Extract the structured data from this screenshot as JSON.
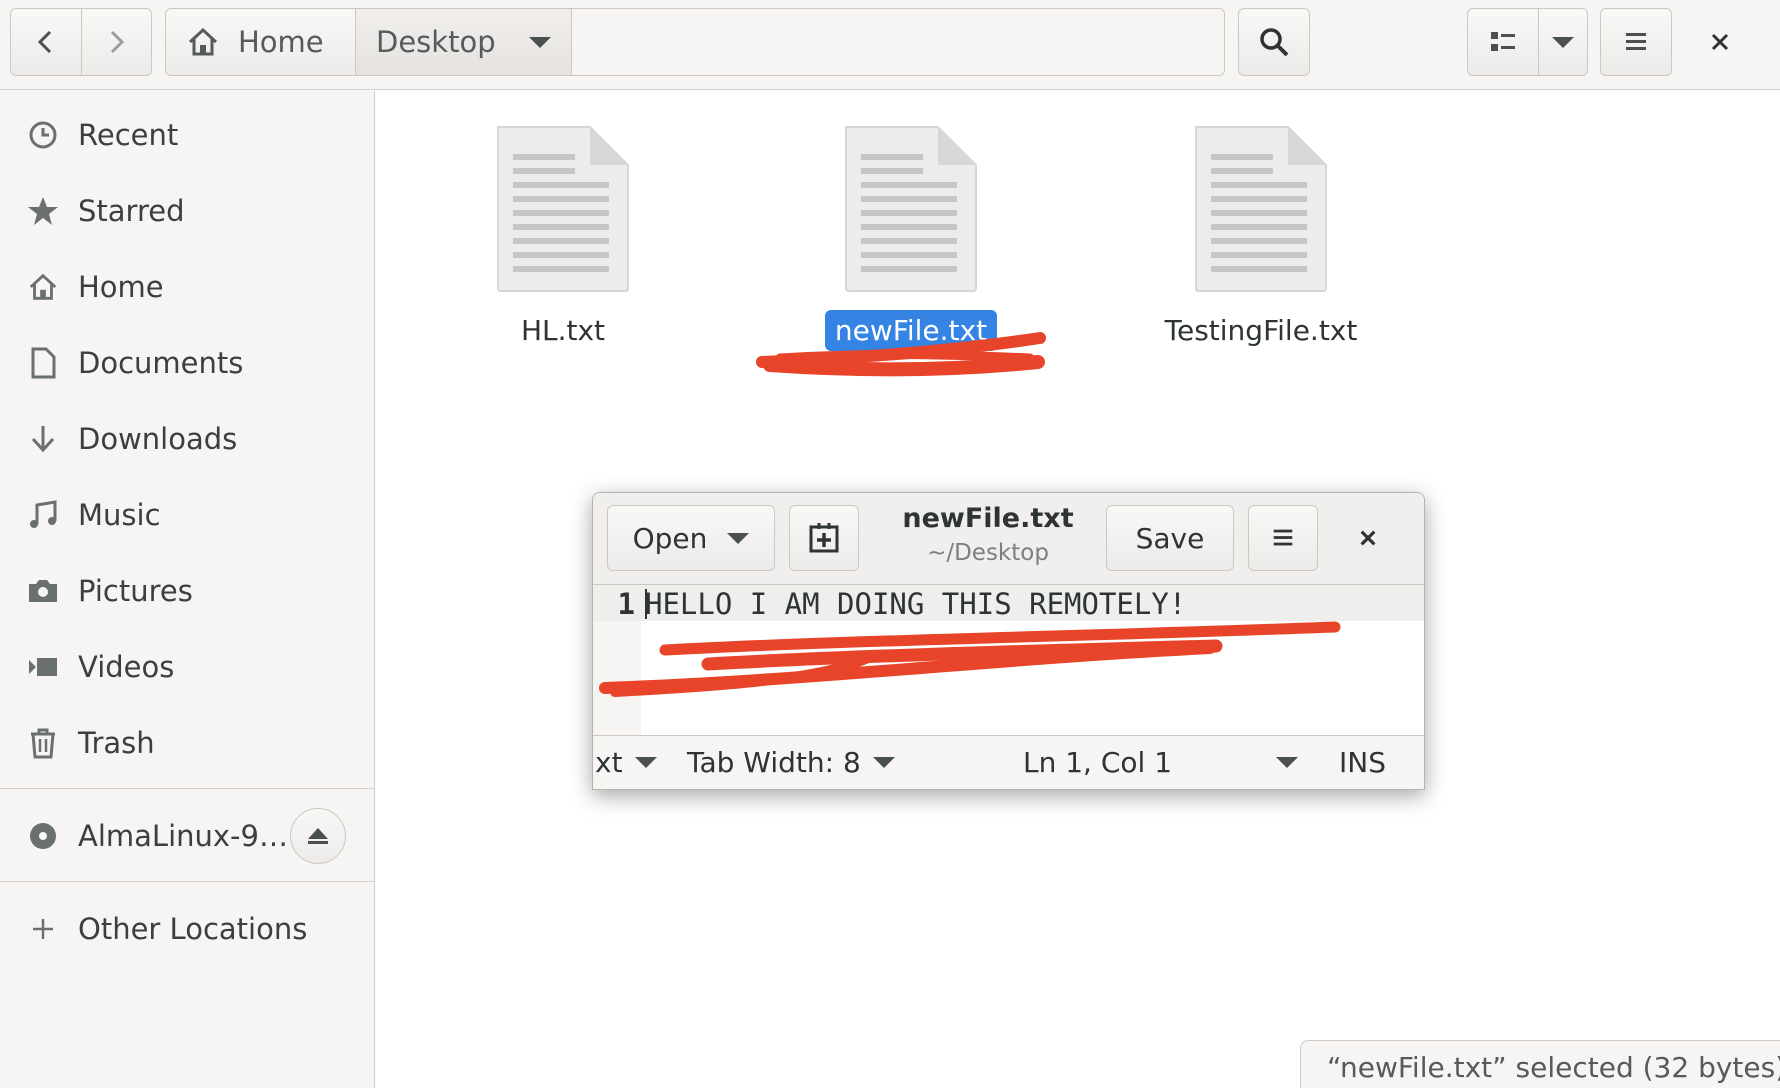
{
  "header": {
    "back_icon": "go-back-icon",
    "forward_icon": "go-forward-icon",
    "breadcrumbs": [
      {
        "label": "Home",
        "icon": "home-icon"
      },
      {
        "label": "Desktop"
      }
    ],
    "search_icon": "search-icon",
    "view_icon": "list-view-icon",
    "menu_icon": "hamburger-icon",
    "close_icon": "close-icon"
  },
  "sidebar": {
    "items": [
      {
        "label": "Recent",
        "icon": "clock-icon"
      },
      {
        "label": "Starred",
        "icon": "star-icon"
      },
      {
        "label": "Home",
        "icon": "home-icon"
      },
      {
        "label": "Documents",
        "icon": "document-icon"
      },
      {
        "label": "Downloads",
        "icon": "download-icon"
      },
      {
        "label": "Music",
        "icon": "music-icon"
      },
      {
        "label": "Pictures",
        "icon": "camera-icon"
      },
      {
        "label": "Videos",
        "icon": "video-icon"
      },
      {
        "label": "Trash",
        "icon": "trash-icon"
      }
    ],
    "device": {
      "label": "AlmaLinux-9…",
      "icon": "disc-icon",
      "eject_icon": "eject-icon"
    },
    "other": {
      "label": "Other Locations",
      "icon": "plus-icon"
    }
  },
  "files": [
    {
      "name": "HL.txt",
      "selected": false
    },
    {
      "name": "newFile.txt",
      "selected": true
    },
    {
      "name": "TestingFile.txt",
      "selected": false
    }
  ],
  "status": {
    "text": "“newFile.txt” selected  (32 bytes)"
  },
  "editor": {
    "open_label": "Open",
    "new_doc_icon": "new-document-icon",
    "title": "newFile.txt",
    "subtitle": "~/Desktop",
    "save_label": "Save",
    "menu_icon": "hamburger-icon",
    "close_icon": "close-icon",
    "line_number": "1",
    "line_text": "HELLO I AM DOING THIS REMOTELY!",
    "status": {
      "language": "xt",
      "tab_width": "Tab Width: 8",
      "position": "Ln 1, Col 1",
      "mode": "INS"
    }
  },
  "colors": {
    "accent": "#3584e4",
    "annotation": "#e8442a"
  }
}
